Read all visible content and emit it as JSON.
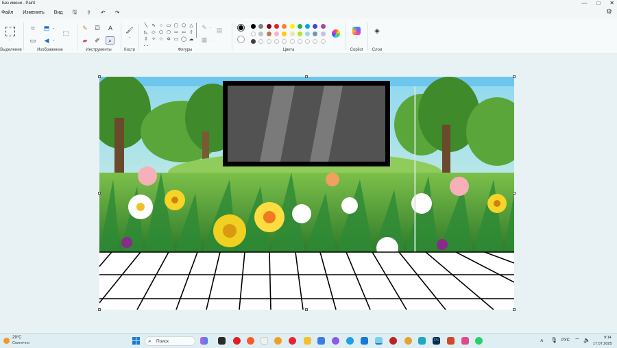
{
  "window": {
    "title": "Без имени - Paint",
    "controls": [
      "—",
      "□",
      "✕"
    ]
  },
  "menu": {
    "items": [
      "Файл",
      "Изменить",
      "Вид"
    ]
  },
  "ribbon": {
    "groups": {
      "selection": "Выделение",
      "image": "Изображение",
      "tools": "Инструменты",
      "brushes": "Кисти",
      "shapes": "Фигуры",
      "colors": "Цвета",
      "copilot": "Copilot",
      "layers": "Слои"
    },
    "text_tool_glyph": "A",
    "primary_color": "#000000",
    "secondary_color": "#ffffff",
    "palette_row1": [
      "#000000",
      "#7f7f7f",
      "#880015",
      "#ed1c24",
      "#ff7f27",
      "#fff200",
      "#22b14c",
      "#00a2e8",
      "#3f48cc",
      "#a349a4"
    ],
    "palette_row2": [
      "#ffffff",
      "#c3c3c3",
      "#b97a57",
      "#ffaec9",
      "#ffc90e",
      "#efe4b0",
      "#b5e61d",
      "#99d9ea",
      "#7092be",
      "#c8bfe7"
    ],
    "palette_row3": [
      "#404040",
      "",
      "",
      "",
      "",
      "",
      "",
      "",
      "",
      ""
    ]
  },
  "taskbar": {
    "weather_temp": "29°C",
    "weather_desc": "Солнечно",
    "search_placeholder": "Поиск",
    "language": "РУС",
    "time": "9:14",
    "date": "17.07.2025"
  }
}
